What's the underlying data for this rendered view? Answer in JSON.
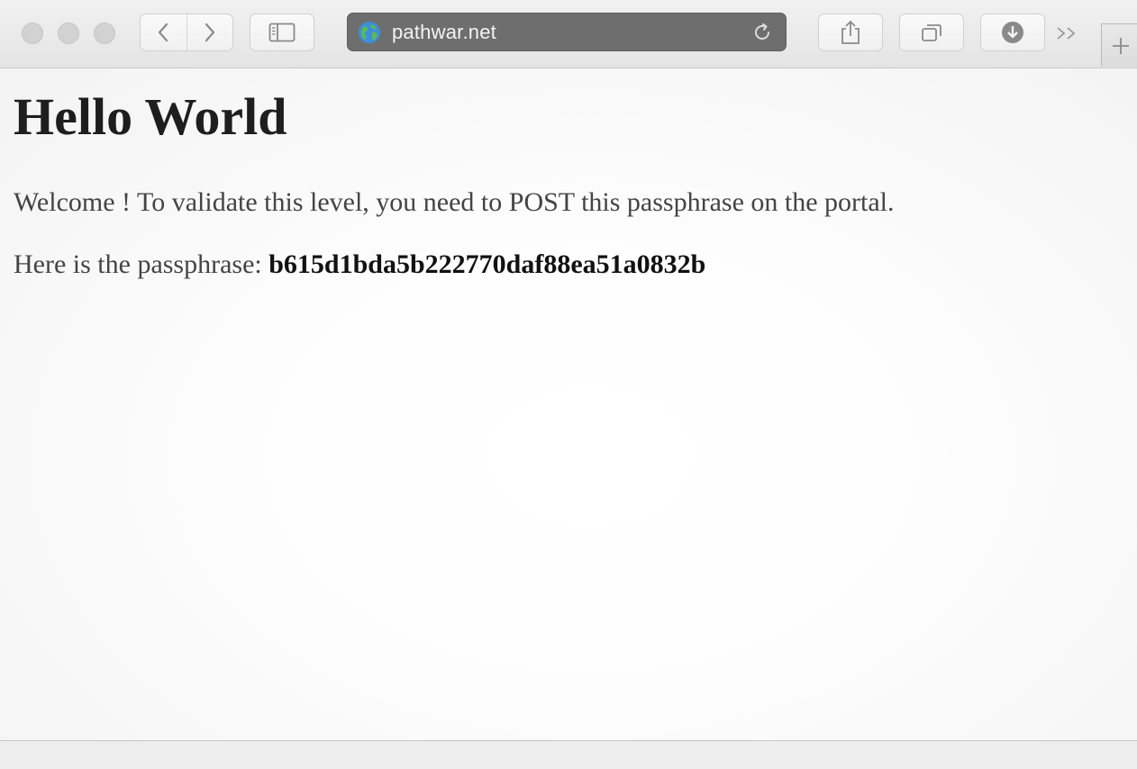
{
  "browser": {
    "url": "pathwar.net",
    "address_bg": "#6e6e6e"
  },
  "icons": {
    "close": "traffic-close-icon",
    "minimize": "traffic-minimize-icon",
    "zoom": "traffic-zoom-icon",
    "back": "chevron-left-icon",
    "forward": "chevron-right-icon",
    "sidebar": "sidebar-icon",
    "globe": "globe-icon",
    "reload": "reload-icon",
    "share": "share-icon",
    "tabs": "tabs-overview-icon",
    "download": "download-icon",
    "overflow": "double-chevron-right-icon",
    "new_tab": "plus-icon"
  },
  "page": {
    "heading": "Hello World",
    "welcome_text": "Welcome ! To validate this level, you need to POST this passphrase on the portal.",
    "passphrase_label": "Here is the passphrase: ",
    "passphrase": "b615d1bda5b222770daf88ea51a0832b"
  }
}
